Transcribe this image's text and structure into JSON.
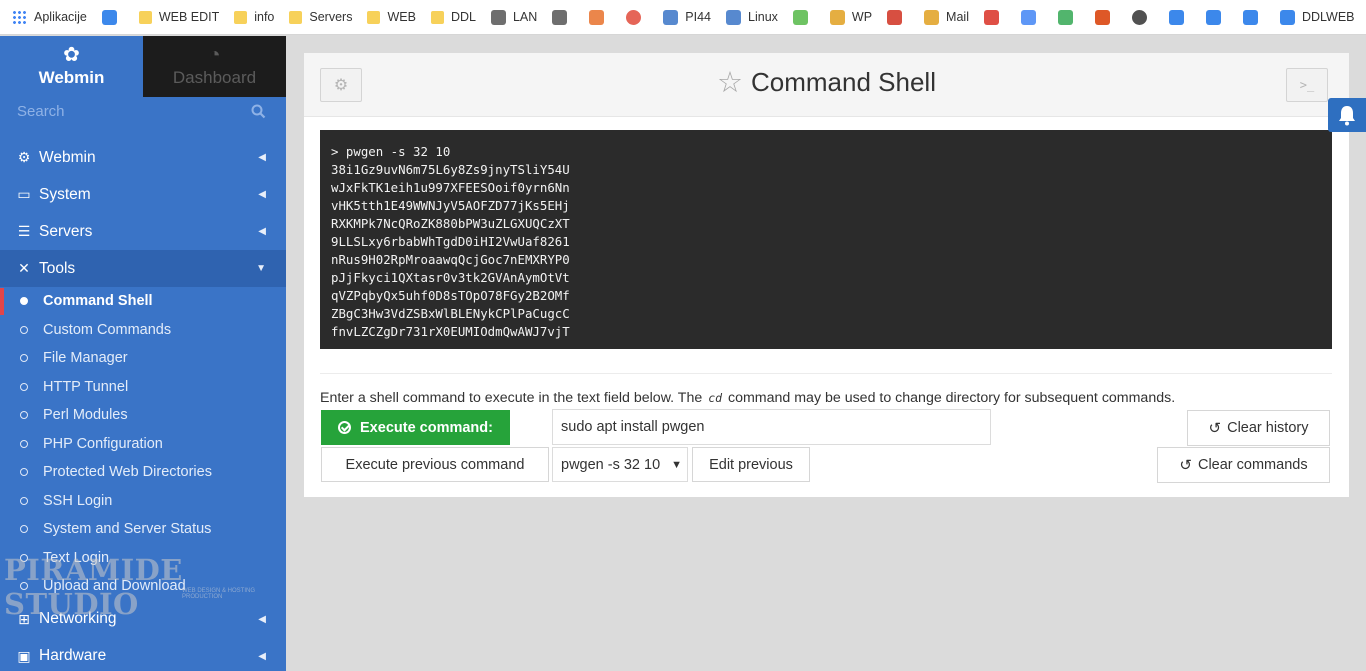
{
  "bookmarks": [
    {
      "label": "Aplikacije",
      "icon": "apps-grid-icon",
      "color": "#4285f4"
    },
    {
      "label": "",
      "icon": "radio-signal-icon",
      "color": "#1a73e8"
    },
    {
      "label": "WEB EDIT",
      "icon": "folder-icon",
      "color": "#f7d15a"
    },
    {
      "label": "info",
      "icon": "folder-icon",
      "color": "#f7d15a"
    },
    {
      "label": "Servers",
      "icon": "folder-icon",
      "color": "#f7d15a"
    },
    {
      "label": "WEB",
      "icon": "folder-icon",
      "color": "#f7d15a"
    },
    {
      "label": "DDL",
      "icon": "folder-icon",
      "color": "#f7d15a"
    },
    {
      "label": "LAN",
      "icon": "lan-icon",
      "color": "#555555"
    },
    {
      "label": "",
      "icon": "network-icon",
      "color": "#555555"
    },
    {
      "label": "",
      "icon": "x-square-icon",
      "color": "#e8712c"
    },
    {
      "label": "",
      "icon": "t-circle-icon",
      "color": "#e04a3a"
    },
    {
      "label": "PI44",
      "icon": "webmin-icon",
      "color": "#3a74c7"
    },
    {
      "label": "Linux",
      "icon": "webmin-icon",
      "color": "#3a74c7"
    },
    {
      "label": "",
      "icon": "leaf-icon",
      "color": "#55b848"
    },
    {
      "label": "WP",
      "icon": "wp-icon",
      "color": "#e0a020"
    },
    {
      "label": "",
      "icon": "pira-icon",
      "color": "#d03020"
    },
    {
      "label": "Mail",
      "icon": "mail-icon",
      "color": "#e0a020"
    },
    {
      "label": "",
      "icon": "gmail-icon",
      "color": "#d93025"
    },
    {
      "label": "",
      "icon": "translate-icon",
      "color": "#4285f4"
    },
    {
      "label": "",
      "icon": "drive-icon",
      "color": "#34a853"
    },
    {
      "label": "",
      "icon": "office-icon",
      "color": "#d83b01"
    },
    {
      "label": "",
      "icon": "speed-icon",
      "color": "#333333"
    },
    {
      "label": "",
      "icon": "gear-icon",
      "color": "#1a73e8"
    },
    {
      "label": "",
      "icon": "star-icon",
      "color": "#1a73e8"
    },
    {
      "label": "",
      "icon": "puzzle-icon",
      "color": "#1a73e8"
    },
    {
      "label": "DDLWEB",
      "icon": "download-icon",
      "color": "#1a73e8"
    }
  ],
  "sidebar": {
    "tab_webmin": "Webmin",
    "tab_dashboard": "Dashboard",
    "search_placeholder": "Search",
    "nav": [
      {
        "label": "Webmin",
        "icon": "gear-icon"
      },
      {
        "label": "System",
        "icon": "laptop-icon"
      },
      {
        "label": "Servers",
        "icon": "servers-icon"
      },
      {
        "label": "Tools",
        "icon": "tools-icon"
      }
    ],
    "tools_items": [
      "Command Shell",
      "Custom Commands",
      "File Manager",
      "HTTP Tunnel",
      "Perl Modules",
      "PHP Configuration",
      "Protected Web Directories",
      "SSH Login",
      "System and Server Status",
      "Text Login",
      "Upload and Download"
    ],
    "nav_bottom": [
      {
        "label": "Networking",
        "icon": "network-icon"
      },
      {
        "label": "Hardware",
        "icon": "hardware-icon"
      }
    ],
    "watermark": "PIRAMIDE STUDIO",
    "watermark_sub": "WEB DESIGN & HOSTING PRODUCTION"
  },
  "page": {
    "title": "Command Shell",
    "terminal_lines": [
      "> pwgen -s 32 10",
      "38i1Gz9uvN6m75L6y8Zs9jnyTSliY54U",
      "wJxFkTK1eih1u997XFEESOoif0yrn6Nn",
      "vHK5tth1E49WWNJyV5AOFZD77jKs5EHj",
      "RXKMPk7NcQRoZK880bPW3uZLGXUQCzXT",
      "9LLSLxy6rbabWhTgdD0iHI2VwUaf8261",
      "nRus9H02RpMroaawqQcjGoc7nEMXRYP0",
      "pJjFkyci1QXtasr0v3tk2GVAnAymOtVt",
      "qVZPqbyQx5uhf0D8sTOpO78FGy2B2OMf",
      "ZBgC3Hw3VdZSBxWlBLENykCPlPaCugcC",
      "fnvLZCZgDr731rX0EUMIOdmQwAWJ7vjT"
    ],
    "hint_before": "Enter a shell command to execute in the text field below. The",
    "hint_code": "cd",
    "hint_after": "command may be used to change directory for subsequent commands.",
    "execute_label": "Execute command:",
    "command_value": "sudo apt install pwgen",
    "clear_history_label": "Clear history",
    "execute_previous_label": "Execute previous command",
    "previous_selected": "pwgen -s 32 10",
    "edit_previous_label": "Edit previous",
    "clear_commands_label": "Clear commands"
  },
  "colors": {
    "sidebar": "#3a74c7",
    "execute_button": "#26a33a",
    "terminal_bg": "#2b2b2b",
    "active_marker": "#e2454a"
  }
}
